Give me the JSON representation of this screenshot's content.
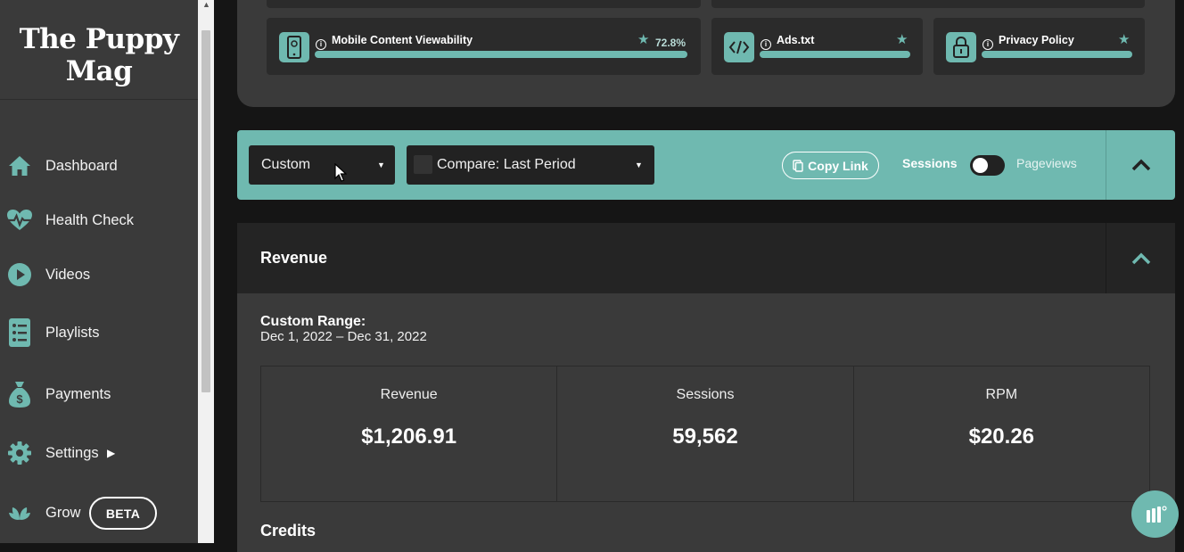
{
  "brand": {
    "line1": "The Puppy",
    "line2": "Mag"
  },
  "sidebar": {
    "items": [
      {
        "label": "Dashboard",
        "icon": "home-icon"
      },
      {
        "label": "Health Check",
        "icon": "heartbeat-icon"
      },
      {
        "label": "Videos",
        "icon": "play-icon"
      },
      {
        "label": "Playlists",
        "icon": "list-icon"
      },
      {
        "label": "Payments",
        "icon": "money-bag-icon"
      },
      {
        "label": "Settings",
        "icon": "gear-icon"
      },
      {
        "label": "Grow",
        "icon": "leaf-icon",
        "badge": "BETA"
      }
    ]
  },
  "health_check": {
    "cards": [
      {
        "title": "Mobile Content Viewability",
        "score": "72.8%",
        "icon": "mobile-icon"
      },
      {
        "title": "Ads.txt",
        "icon": "code-icon"
      },
      {
        "title": "Privacy Policy",
        "icon": "lock-icon"
      }
    ]
  },
  "toolbar": {
    "date_select": "Custom",
    "compare_select": "Compare: Last Period",
    "copy_link": "Copy Link",
    "toggle_left": "Sessions",
    "toggle_right": "Pageviews"
  },
  "revenue": {
    "title": "Revenue",
    "range_label": "Custom Range:",
    "range_value": "Dec 1, 2022 – Dec 31, 2022",
    "stats": [
      {
        "label": "Revenue",
        "value": "$1,206.91"
      },
      {
        "label": "Sessions",
        "value": "59,562"
      },
      {
        "label": "RPM",
        "value": "$20.26"
      }
    ],
    "credits_title": "Credits"
  },
  "colors": {
    "accent": "#6fb9b0",
    "sidebar": "#3a3a3a",
    "panel": "#3a3a3a",
    "background": "#151515"
  }
}
